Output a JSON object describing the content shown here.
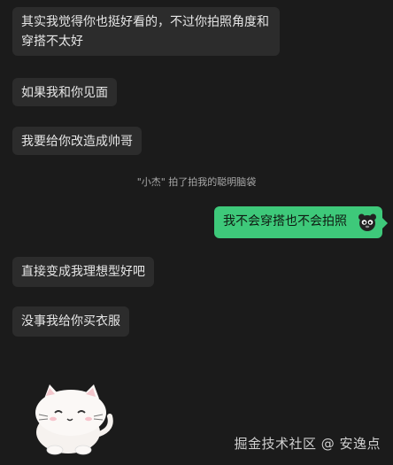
{
  "messages": [
    {
      "side": "left",
      "text_line1": "其实我觉得你也挺好看的，不过你拍照角度和",
      "text_line2": "穿搭不太好"
    },
    {
      "side": "left",
      "text": "如果我和你见面"
    },
    {
      "side": "left",
      "text": "我要给你改造成帅哥"
    },
    {
      "side": "right",
      "text": "我不会穿搭也不会拍照"
    },
    {
      "side": "left",
      "text": "直接变成我理想型好吧"
    },
    {
      "side": "left",
      "text": "没事我给你买衣服"
    }
  ],
  "system_note": "\"小杰\" 拍了拍我的聪明脑袋",
  "icons": {
    "bear": "bear-face-icon",
    "sticker": "white-cat-sticker"
  },
  "watermark": "掘金技术社区 @ 安逸点",
  "colors": {
    "background": "#1b1b1b",
    "left_bubble": "#2c2c2c",
    "right_bubble": "#3ec97a"
  }
}
